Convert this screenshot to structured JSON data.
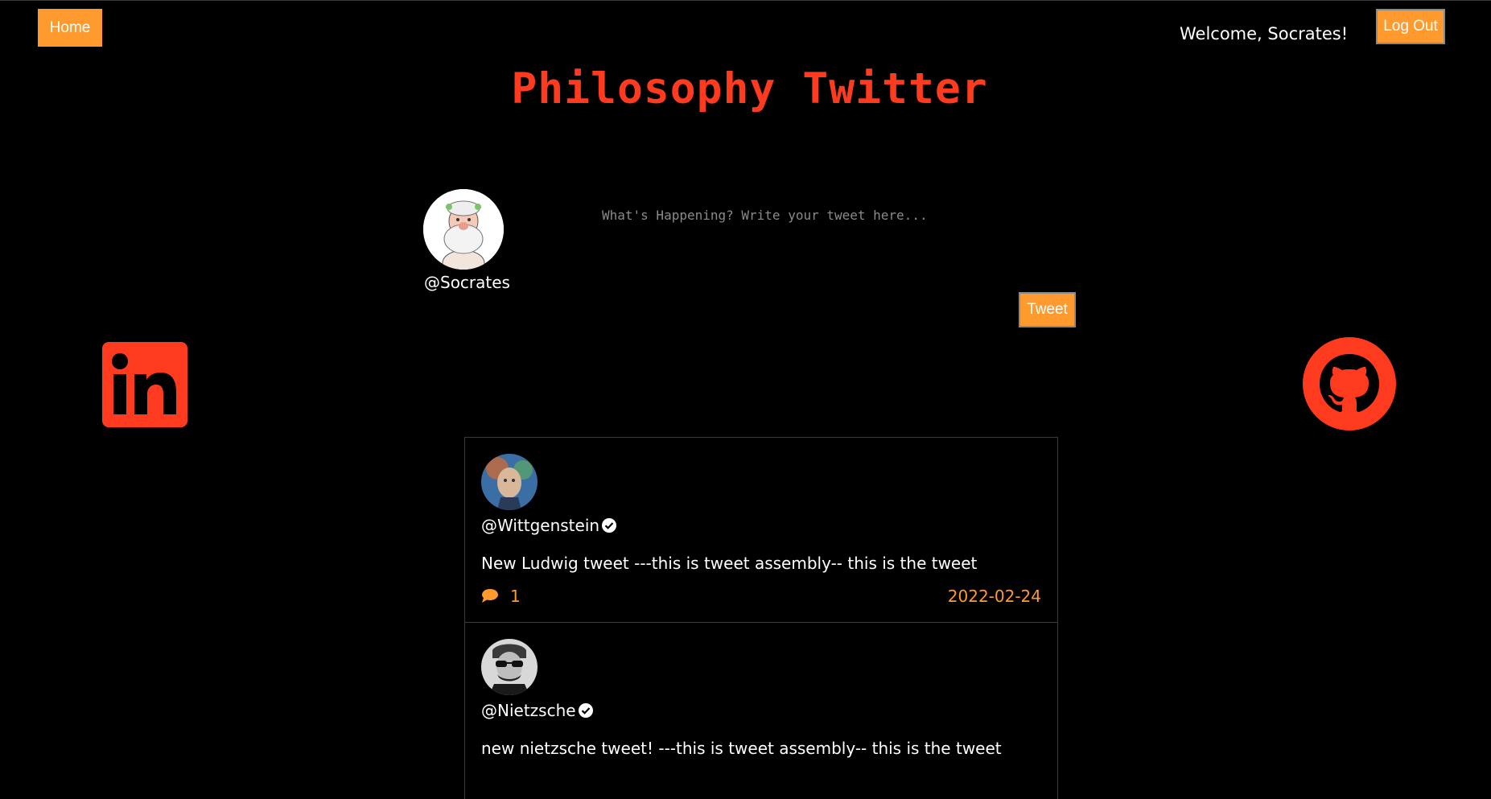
{
  "header": {
    "home_label": "Home",
    "welcome_text": "Welcome, Socrates!",
    "logout_label": "Log Out",
    "site_title": "Philosophy Twitter"
  },
  "compose": {
    "user_handle": "@Socrates",
    "placeholder": "What's Happening? Write your tweet here...",
    "tweet_label": "Tweet"
  },
  "social": {
    "linkedin_icon": "linkedin-icon",
    "github_icon": "github-icon"
  },
  "tweets": [
    {
      "handle": "@Wittgenstein",
      "verified": true,
      "text": "New Ludwig tweet ---this is tweet assembly-- this is the tweet",
      "comment_count": "1",
      "date": "2022-02-24"
    },
    {
      "handle": "@Nietzsche",
      "verified": true,
      "text": "new nietzsche tweet! ---this is tweet assembly-- this is the tweet"
    }
  ],
  "colors": {
    "background": "#000000",
    "accent_orange": "#ff9a2e",
    "title_red": "#ff3b1f",
    "border": "#3a3a3a"
  }
}
